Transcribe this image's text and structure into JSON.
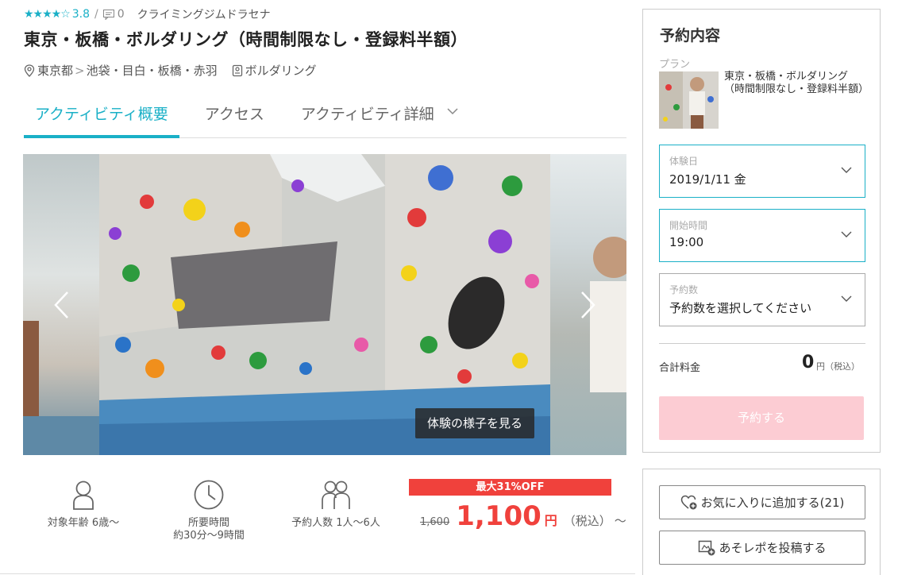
{
  "header": {
    "stars": "★★★★☆",
    "rating": "3.8",
    "separator": "/",
    "review_count": "0",
    "shop_name": "クライミングジムドラセナ",
    "title": "東京・板橋・ボルダリング（時間制限なし・登録料半額）",
    "location": {
      "prefecture": "東京都",
      "crumb_sep": ">",
      "area": "池袋・目白・板橋・赤羽",
      "category": "ボルダリング"
    }
  },
  "tabs": [
    {
      "label": "アクティビティ概要",
      "active": true
    },
    {
      "label": "アクセス",
      "active": false
    },
    {
      "label": "アクティビティ詳細",
      "active": false
    }
  ],
  "gallery": {
    "view_button": "体験の様子を見る"
  },
  "info": {
    "age": "対象年齢 6歳〜",
    "duration_label": "所要時間",
    "duration_value": "約30分〜9時間",
    "people": "予約人数 1人〜6人"
  },
  "price": {
    "discount_badge": "最大31%OFF",
    "original": "1,600",
    "current": "1,100",
    "yen": "円",
    "tax_note": "（税込）",
    "tilde": "〜"
  },
  "booking": {
    "title": "予約内容",
    "plan_label": "プラン",
    "plan_name": "東京・板橋・ボルダリング（時間制限なし・登録料半額）",
    "date_label": "体験日",
    "date_value": "2019/1/11 金",
    "time_label": "開始時間",
    "time_value": "19:00",
    "count_label": "予約数",
    "count_placeholder": "予約数を選択してください",
    "total_label": "合計料金",
    "total_value": "0",
    "total_unit": "円（税込）",
    "reserve_button": "予約する"
  },
  "actions": {
    "favorite_button": "お気に入りに追加する(21)",
    "report_button": "あそレポを投稿する"
  },
  "colors": {
    "accent": "#1ab0c7",
    "sale": "#f0413c",
    "reserve_disabled": "#fcccd3"
  }
}
